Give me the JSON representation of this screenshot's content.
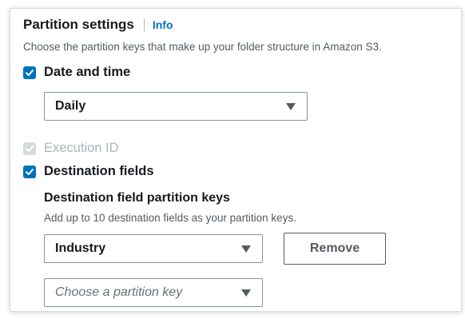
{
  "section": {
    "title": "Partition settings",
    "info_link": "Info",
    "description": "Choose the partition keys that make up your folder structure in Amazon S3."
  },
  "options": {
    "date_time": {
      "label": "Date and time",
      "checked": true,
      "disabled": false
    },
    "execution_id": {
      "label": "Execution ID",
      "checked": true,
      "disabled": true
    },
    "destination_fields": {
      "label": "Destination fields",
      "checked": true,
      "disabled": false
    }
  },
  "date_time_select": {
    "value": "Daily"
  },
  "destination_field_keys": {
    "title": "Destination field partition keys",
    "description": "Add up to 10 destination fields as your partition keys.",
    "keys": [
      {
        "value": "Industry"
      }
    ],
    "remove_label": "Remove",
    "new_key_placeholder": "Choose a partition key"
  },
  "colors": {
    "accent": "#0073bb",
    "disabled": "#aab7b8",
    "text": "#16191f",
    "muted": "#545b64"
  },
  "icons": {
    "checkbox": "check-icon",
    "dropdown": "caret-down-icon"
  }
}
